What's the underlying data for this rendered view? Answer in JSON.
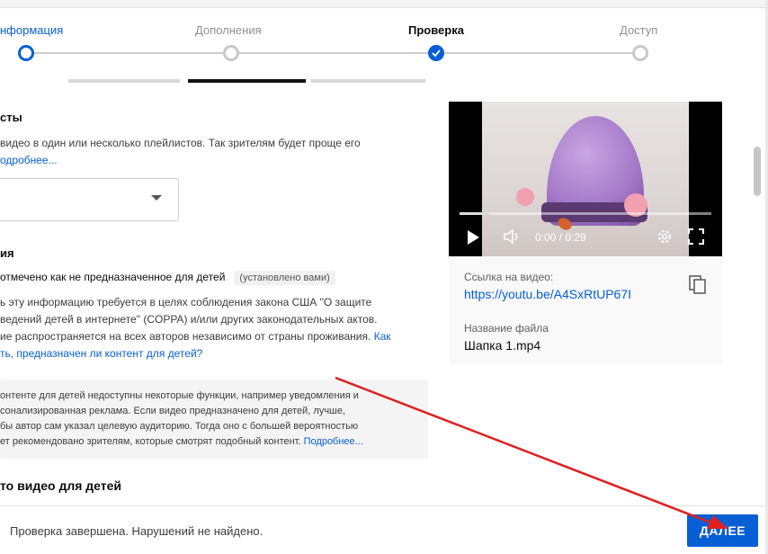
{
  "stepper": {
    "steps": [
      {
        "label": "нформация"
      },
      {
        "label": "Дополнения"
      },
      {
        "label": "Проверка"
      },
      {
        "label": "Доступ"
      }
    ]
  },
  "playlists": {
    "title": "сты",
    "text_line1": " видео в один или несколько плейлистов. Так зрителям будет проще его",
    "more_link": "одробнее..."
  },
  "audience": {
    "title": "ия",
    "status": "отмечено как не предназначенное для детей",
    "chip": "(установлено вами)",
    "text_line1": "ь эту информацию требуется в целях соблюдения закона США \"О защите",
    "text_line2": "ведений детей в интернете\" (COPPA) и/или других законодательных актов.",
    "text_line3": "ие распространяется на всех авторов независимо от страны проживания. ",
    "text_link_end": "Как",
    "text_line4_link": "ть, предназначен ли контент для детей?",
    "info_line1": "онтенте для детей недоступны некоторые функции, например уведомления и",
    "info_line2": "сонализированная реклама. Если видео предназначено для детей, лучше,",
    "info_line3": "бы автор сам указал целевую аудиторию. Тогда оно с большей вероятностью",
    "info_line4": "ет рекомендовано зрителям, которые смотрят подобный контент. ",
    "info_more": "Подробнее...",
    "bottom_title": "то видео для детей"
  },
  "video": {
    "time": "0:00 / 0:29",
    "progress": 0.12,
    "link_label": "Ссылка на видео:",
    "link": "https://youtu.be/A4SxRtUP67I",
    "file_label": "Название файла",
    "file_name": "Шапка 1.mp4"
  },
  "footer": {
    "status": "Проверка завершена. Нарушений не найдено.",
    "next_label": "ДАЛЕЕ"
  },
  "colors": {
    "accent": "#065fd4",
    "annotation": "#e02020"
  }
}
